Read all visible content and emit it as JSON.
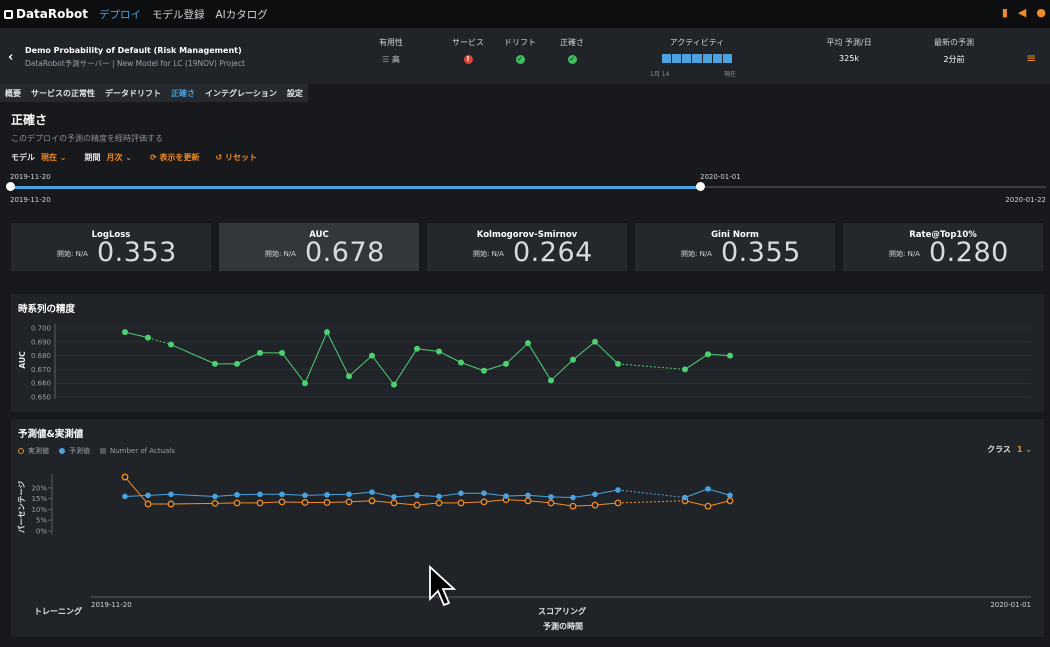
{
  "app": {
    "brand": "DataRobot",
    "nav": [
      "デプロイ",
      "モデル登録",
      "AIカタログ"
    ],
    "active_nav": 0
  },
  "header": {
    "back_icon": "chevron-left-icon",
    "deployment_title": "Demo Probability of Default (Risk Management)",
    "deployment_subtitle": "DataRobot予測サーバー | New Model for LC (19NOV) Project",
    "availability_label": "有用性",
    "availability_value": "高",
    "service_label": "サービス",
    "service_status": "error",
    "drift_label": "ドリフト",
    "drift_status": "ok",
    "accuracy_label": "正確さ",
    "accuracy_status": "ok",
    "activity_label": "アクティビティ",
    "activity_start": "1月 14",
    "activity_end": "現在",
    "avg_label": "平均 予測/日",
    "avg_value": "325k",
    "latest_label": "最新の予測",
    "latest_value": "2分前"
  },
  "tabs": [
    "概要",
    "サービスの正常性",
    "データドリフト",
    "正確さ",
    "インテグレーション",
    "設定"
  ],
  "active_tab": 3,
  "page": {
    "title": "正確さ",
    "description": "このデプロイの予測の精度を経時評価する",
    "model_label": "モデル",
    "model_value": "現在",
    "period_label": "期間",
    "period_value": "月次",
    "refresh_label": "表示を更新",
    "reset_label": "リセット"
  },
  "slider": {
    "handle_start_label": "2019-11-20",
    "handle_end_label": "2020-01-01",
    "range_start": "2019-11-20",
    "range_end": "2020-01-22"
  },
  "metrics": [
    {
      "name": "LogLoss",
      "start": "開始: N/A",
      "value": "0.353"
    },
    {
      "name": "AUC",
      "start": "開始: N/A",
      "value": "0.678"
    },
    {
      "name": "Kolmogorov-Smirnov",
      "start": "開始: N/A",
      "value": "0.264"
    },
    {
      "name": "Gini Norm",
      "start": "開始: N/A",
      "value": "0.355"
    },
    {
      "name": "Rate@Top10%",
      "start": "開始: N/A",
      "value": "0.280"
    }
  ],
  "accuracy_panel": {
    "title": "時系列の精度"
  },
  "pred_panel": {
    "title": "予測値&実測値",
    "legend_actual": "実測値",
    "legend_predicted": "予測値",
    "legend_count": "Number of Actuals",
    "class_label": "クラス",
    "class_value": "1",
    "training_label": "トレーニング",
    "scoring_label": "スコアリング",
    "time_label": "予測の時間"
  },
  "colors": {
    "accent": "#4aa3df",
    "orange": "#f28c28",
    "green": "#4cd070",
    "error": "#e0453a"
  },
  "chart_data": [
    {
      "type": "line",
      "ylabel": "AUC",
      "ylim": [
        0.65,
        0.7
      ],
      "yticks": [
        "0.700",
        "0.690",
        "0.680",
        "0.670",
        "0.660",
        "0.650"
      ],
      "series": [
        {
          "values": [
            0.697,
            0.693,
            0.688,
            0.674,
            0.674,
            0.682,
            0.682,
            0.66,
            0.697,
            0.665,
            0.68,
            0.659,
            0.685,
            0.683,
            0.675,
            0.669,
            0.674,
            0.689,
            0.662,
            0.677,
            0.69,
            0.674,
            0.67,
            0.681,
            0.68
          ]
        }
      ],
      "dashed_after": [
        1,
        21
      ]
    },
    {
      "type": "line",
      "ylabel": "パーセンテージ",
      "yticks": [
        "20%",
        "15%",
        "10%",
        "5%",
        "0%"
      ],
      "ylim": [
        0,
        25
      ],
      "x_start": "2019-11-20",
      "x_end": "2020-01-01",
      "series": [
        {
          "name": "実測値",
          "values": [
            25,
            12.5,
            12.5,
            12.8,
            13,
            13,
            13.5,
            13.2,
            13.2,
            13.5,
            14,
            13,
            12,
            13,
            13,
            13.5,
            14.5,
            14,
            13,
            11.5,
            12,
            13,
            14,
            11.5,
            14,
            14.5
          ]
        },
        {
          "name": "予測値",
          "values": [
            16,
            16.5,
            17,
            16,
            16.8,
            17,
            17,
            16.5,
            16.8,
            17,
            18,
            15.8,
            16.5,
            16,
            17.5,
            17.5,
            16.2,
            16.5,
            15.8,
            15.5,
            17,
            19,
            15.5,
            19.5,
            16.5,
            16.5
          ]
        }
      ]
    }
  ]
}
